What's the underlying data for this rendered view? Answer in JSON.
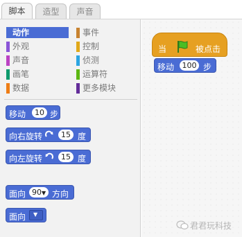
{
  "tabs": [
    {
      "label": "脚本",
      "active": true
    },
    {
      "label": "造型",
      "active": false
    },
    {
      "label": "声音",
      "active": false
    }
  ],
  "categories": [
    {
      "label": "动作",
      "color": "#4a6cd4",
      "active": true
    },
    {
      "label": "外观",
      "color": "#8a55d7"
    },
    {
      "label": "声音",
      "color": "#bb42c3"
    },
    {
      "label": "画笔",
      "color": "#0e9a6c"
    },
    {
      "label": "数据",
      "color": "#ee7d16"
    },
    {
      "label": "事件",
      "color": "#c88330"
    },
    {
      "label": "控制",
      "color": "#e1a91a"
    },
    {
      "label": "侦测",
      "color": "#2ca5e2"
    },
    {
      "label": "运算符",
      "color": "#5cb712"
    },
    {
      "label": "更多模块",
      "color": "#632d99"
    }
  ],
  "palette_blocks": {
    "move": {
      "text": "移动",
      "value": "10",
      "suffix": "步"
    },
    "turn_right": {
      "text": "向右旋转",
      "icon": "rotate-clockwise-icon",
      "value": "15",
      "suffix": "度"
    },
    "turn_left": {
      "text": "向左旋转",
      "icon": "rotate-counterclockwise-icon",
      "value": "15",
      "suffix": "度"
    },
    "point_direction": {
      "text": "面向",
      "value": "90",
      "suffix": "方向"
    },
    "point_towards": {
      "text": "面向"
    }
  },
  "script": {
    "hat": {
      "prefix": "当",
      "icon": "green-flag-icon",
      "suffix": "被点击",
      "color": "#e6a022"
    },
    "move": {
      "text": "移动",
      "value": "100",
      "suffix": "步"
    }
  },
  "watermark": {
    "text": "君君玩科技",
    "icon": "wechat-icon"
  }
}
